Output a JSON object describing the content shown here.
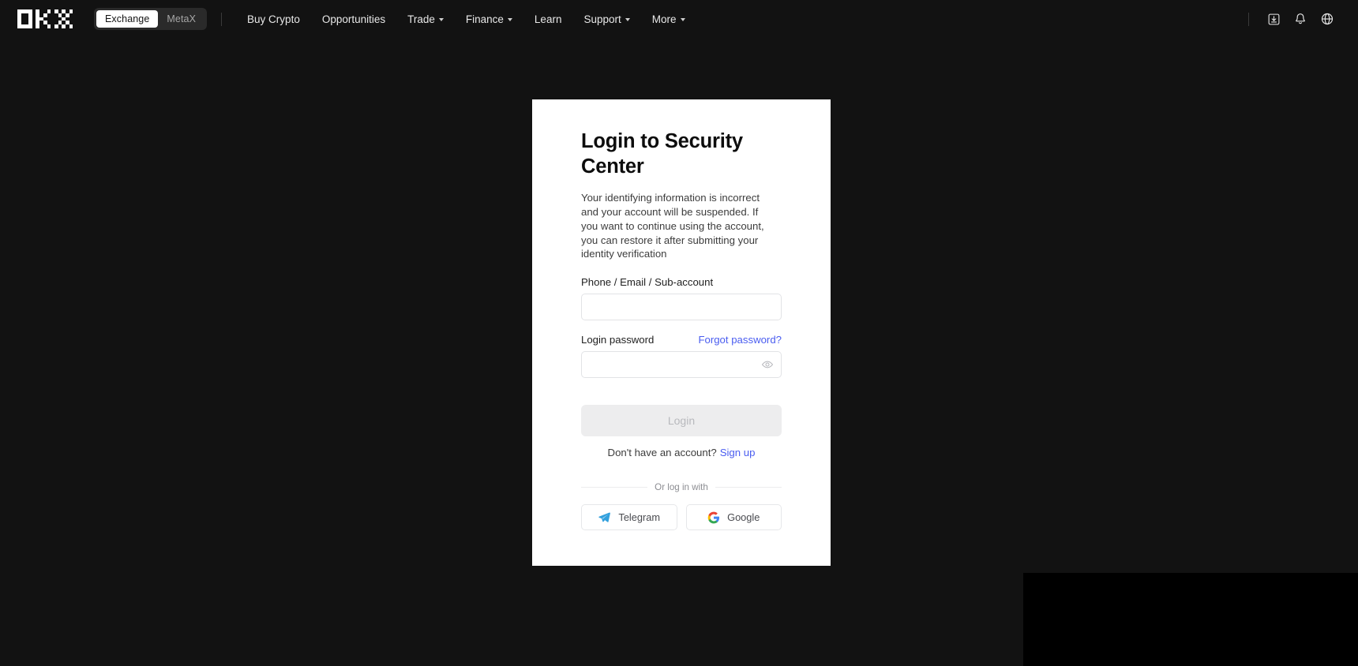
{
  "header": {
    "logo_alt": "OKX",
    "segmented": {
      "items": [
        {
          "label": "Exchange",
          "active": true
        },
        {
          "label": "MetaX",
          "active": false
        }
      ]
    },
    "nav": [
      {
        "label": "Buy Crypto",
        "caret": false
      },
      {
        "label": "Opportunities",
        "caret": false
      },
      {
        "label": "Trade",
        "caret": true
      },
      {
        "label": "Finance",
        "caret": true
      },
      {
        "label": "Learn",
        "caret": false
      },
      {
        "label": "Support",
        "caret": true
      },
      {
        "label": "More",
        "caret": true
      }
    ],
    "actions": [
      {
        "name": "download-icon",
        "label": "Download"
      },
      {
        "name": "bell-icon",
        "label": "Notifications"
      },
      {
        "name": "globe-icon",
        "label": "Language"
      }
    ]
  },
  "login_card": {
    "title": "Login to Security Center",
    "description": "Your identifying information is incorrect and your account will be suspended. If you want to continue using the account, you can restore it after submitting your identity verification",
    "account_field": {
      "label": "Phone / Email / Sub-account",
      "value": "",
      "placeholder": ""
    },
    "password_field": {
      "label": "Login password",
      "value": "",
      "placeholder": "",
      "forgot_link": "Forgot password?",
      "toggle_icon": "eye-icon"
    },
    "submit_label": "Login",
    "signup_prompt": "Don't have an account?",
    "signup_link": "Sign up",
    "divider_text": "Or log in with",
    "social": [
      {
        "label": "Telegram",
        "icon": "telegram-icon"
      },
      {
        "label": "Google",
        "icon": "google-icon"
      }
    ]
  },
  "colors": {
    "nav_background": "#121212",
    "card_background": "#ffffff",
    "link": "#4a5df0",
    "submit_disabled_bg": "#ededee",
    "submit_disabled_text": "#b8b9bd",
    "telegram_blue": "#32a0dd",
    "google_blue": "#4285f4",
    "google_green": "#34a853",
    "google_yellow": "#fbbc05",
    "google_red": "#ea4335"
  }
}
